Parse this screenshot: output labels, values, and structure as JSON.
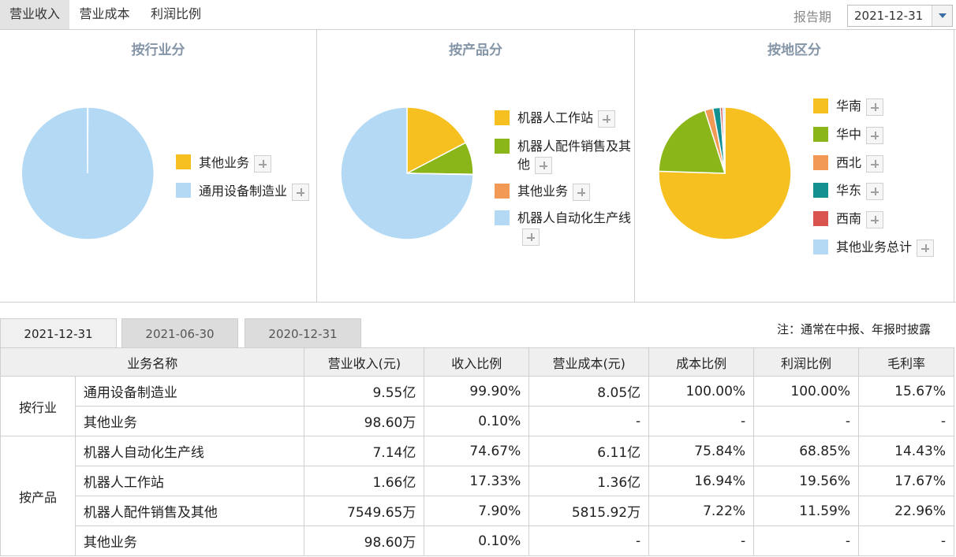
{
  "top_tabs": [
    "营业收入",
    "营业成本",
    "利润比例"
  ],
  "report_period": {
    "label": "报告期",
    "value": "2021-12-31"
  },
  "chart_data": [
    {
      "type": "pie",
      "title": "按行业分",
      "categories": [
        "其他业务",
        "通用设备制造业"
      ],
      "values": [
        0.1,
        99.9
      ],
      "colors": [
        "#f5c020",
        "#b3d9f5"
      ]
    },
    {
      "type": "pie",
      "title": "按产品分",
      "categories": [
        "机器人工作站",
        "机器人配件销售及其他",
        "其他业务",
        "机器人自动化生产线"
      ],
      "values": [
        17.33,
        7.9,
        0.1,
        74.67
      ],
      "colors": [
        "#f5c020",
        "#8bb61a",
        "#f29a55",
        "#b3d9f5"
      ]
    },
    {
      "type": "pie",
      "title": "按地区分",
      "categories": [
        "华南",
        "华中",
        "西北",
        "华东",
        "西南",
        "其他业务总计"
      ],
      "values": [
        75.5,
        19.6,
        2.0,
        1.8,
        0.6,
        0.5
      ],
      "colors": [
        "#f5c020",
        "#8bb61a",
        "#f29a55",
        "#139191",
        "#d9534f",
        "#b3d9f5"
      ]
    }
  ],
  "period_tabs": [
    "2021-12-31",
    "2021-06-30",
    "2020-12-31"
  ],
  "note": "注：通常在中报、年报时披露",
  "table": {
    "headers": [
      "业务名称",
      "营业收入(元)",
      "收入比例",
      "营业成本(元)",
      "成本比例",
      "利润比例",
      "毛利率"
    ],
    "groups": [
      {
        "name": "按行业",
        "rows": [
          [
            "通用设备制造业",
            "9.55亿",
            "99.90%",
            "8.05亿",
            "100.00%",
            "100.00%",
            "15.67%"
          ],
          [
            "其他业务",
            "98.60万",
            "0.10%",
            "-",
            "-",
            "-",
            "-"
          ]
        ]
      },
      {
        "name": "按产品",
        "rows": [
          [
            "机器人自动化生产线",
            "7.14亿",
            "74.67%",
            "6.11亿",
            "75.84%",
            "68.85%",
            "14.43%"
          ],
          [
            "机器人工作站",
            "1.66亿",
            "17.33%",
            "1.36亿",
            "16.94%",
            "19.56%",
            "17.67%"
          ],
          [
            "机器人配件销售及其他",
            "7549.65万",
            "7.90%",
            "5815.92万",
            "7.22%",
            "11.59%",
            "22.96%"
          ],
          [
            "其他业务",
            "98.60万",
            "0.10%",
            "-",
            "-",
            "-",
            "-"
          ]
        ]
      }
    ]
  }
}
